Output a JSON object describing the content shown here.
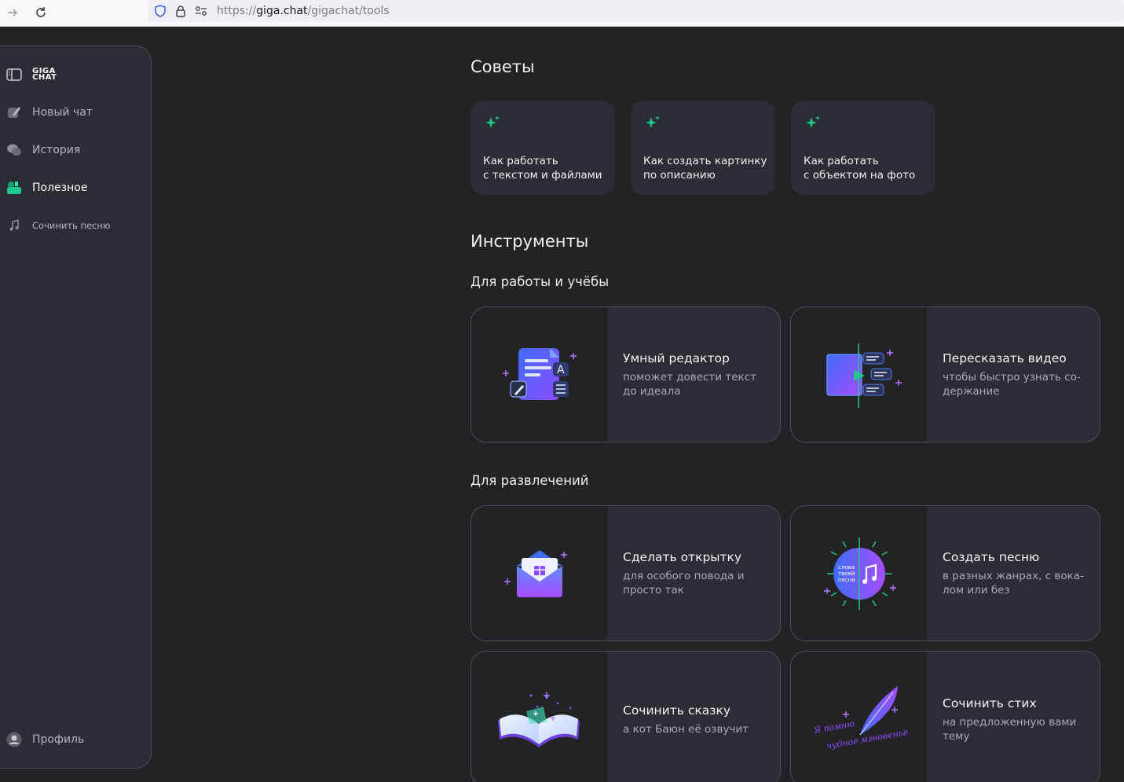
{
  "browser": {
    "url_scheme": "https://",
    "url_host": "giga.chat",
    "url_path": "/gigachat/tools"
  },
  "sidebar": {
    "logo_line1": "GIGA",
    "logo_line2": "CHAT",
    "items": [
      {
        "label": "Новый чат",
        "icon": "pencil-icon"
      },
      {
        "label": "История",
        "icon": "chat-bubbles-icon"
      },
      {
        "label": "Полезное",
        "icon": "tools-icon",
        "active": true
      },
      {
        "label": "Сочинить песню",
        "icon": "music-note-icon"
      }
    ],
    "profile_label": "Профиль"
  },
  "tips": {
    "title": "Советы",
    "items": [
      {
        "line1": "Как работать",
        "line2": "с текстом и файлами"
      },
      {
        "line1": "Как создать картинку",
        "line2": "по описанию"
      },
      {
        "line1": "Как работать",
        "line2": "с объектом на фото"
      }
    ]
  },
  "tools": {
    "title": "Инструменты",
    "work_title": "Для работы и учёбы",
    "fun_title": "Для развлечений",
    "items": [
      {
        "name": "Умный редактор",
        "desc": "поможет довести текст до идеала"
      },
      {
        "name": "Пересказать видео",
        "desc": "чтобы быстро узнать со­держание"
      },
      {
        "name": "Сделать открытку",
        "desc": "для особого повода и просто так"
      },
      {
        "name": "Создать песню",
        "desc": "в разных жанрах, с вока­лом или без"
      },
      {
        "name": "Сочинить сказку",
        "desc": "а кот Баюн её озвучит"
      },
      {
        "name": "Сочинить стих",
        "desc": "на предложенную вами тему"
      }
    ],
    "song_art_text": [
      "слова",
      "твоей",
      "песни"
    ],
    "poem_art_text": [
      "Я помню",
      "чудное мгновенье"
    ]
  },
  "colors": {
    "accent_green": "#21c98b",
    "accent_purple": "#8a4dff",
    "accent_blue": "#3f6cf5"
  }
}
